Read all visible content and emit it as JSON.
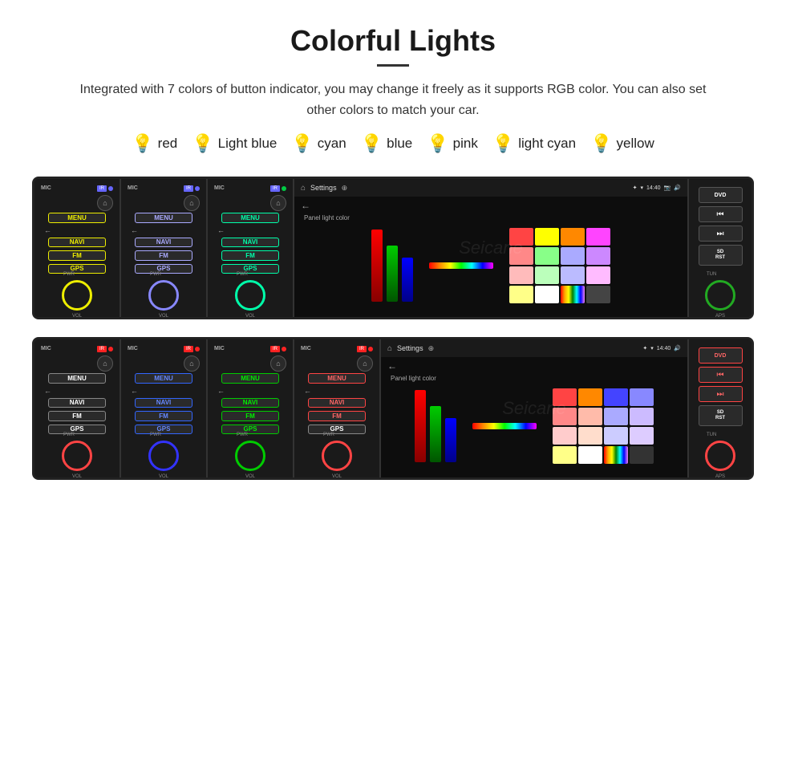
{
  "header": {
    "title": "Colorful Lights",
    "description": "Integrated with 7 colors of button indicator, you may change it freely as it supports RGB color. You can also set other colors to match your car."
  },
  "colors": [
    {
      "name": "red",
      "emoji": "🔴",
      "hex": "#ff2222"
    },
    {
      "name": "Light blue",
      "emoji": "🔵",
      "hex": "#88ccff"
    },
    {
      "name": "cyan",
      "emoji": "🔵",
      "hex": "#00ffff"
    },
    {
      "name": "blue",
      "emoji": "🔵",
      "hex": "#2255ff"
    },
    {
      "name": "pink",
      "emoji": "🟣",
      "hex": "#ff44aa"
    },
    {
      "name": "light cyan",
      "emoji": "🔵",
      "hex": "#aaffff"
    },
    {
      "name": "yellow",
      "emoji": "🟡",
      "hex": "#ffee00"
    }
  ],
  "units": [
    {
      "id": "unit-top",
      "panels": [
        {
          "knob_color": "#eeee00",
          "btn_color": "#eeee00",
          "ir_dot": "#6666ff"
        },
        {
          "knob_color": "#8888ff",
          "btn_color": "#aaaaff",
          "ir_dot": "#6666ff"
        },
        {
          "knob_color": "#00ffaa",
          "btn_color": "#00ffaa",
          "ir_dot": "#6666ff"
        }
      ]
    },
    {
      "id": "unit-bottom",
      "panels": [
        {
          "knob_color": "#ff4444",
          "btn_color": "#ff4444",
          "ir_dot": "#ff2222"
        },
        {
          "knob_color": "#3333ff",
          "btn_color": "#3333ff",
          "ir_dot": "#ff2222"
        },
        {
          "knob_color": "#00cc00",
          "btn_color": "#00cc00",
          "ir_dot": "#ff2222"
        },
        {
          "knob_color": "#ff4444",
          "btn_color": "#ff4444",
          "ir_dot": "#ff2222"
        }
      ]
    }
  ],
  "watermark": "Seicane",
  "screen": {
    "title": "Settings",
    "time": "14:40",
    "panel_light_label": "Panel light color"
  }
}
